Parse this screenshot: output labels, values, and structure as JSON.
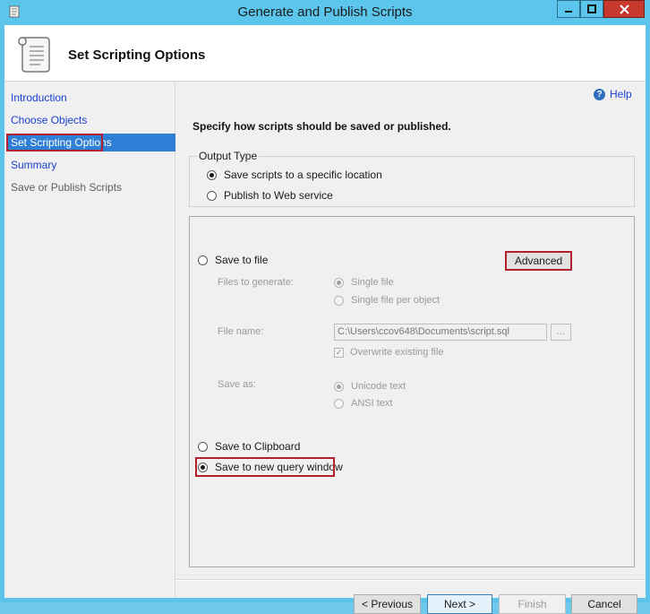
{
  "window": {
    "title": "Generate and Publish Scripts"
  },
  "header": {
    "title": "Set Scripting Options",
    "icon": "scroll-icon"
  },
  "sidebar": {
    "items": [
      {
        "label": "Introduction",
        "state": "link"
      },
      {
        "label": "Choose Objects",
        "state": "link"
      },
      {
        "label": "Set Scripting Options",
        "state": "active"
      },
      {
        "label": "Summary",
        "state": "link"
      },
      {
        "label": "Save or Publish Scripts",
        "state": "disabled"
      }
    ]
  },
  "main": {
    "help_label": "Help",
    "intro": "Specify how scripts should be saved or published.",
    "output_type": {
      "legend": "Output Type",
      "options": [
        {
          "label": "Save scripts to a specific location",
          "selected": true
        },
        {
          "label": "Publish to Web service",
          "selected": false
        }
      ]
    },
    "save": {
      "save_to_file_label": "Save to file",
      "advanced_label": "Advanced",
      "files_to_generate_label": "Files to generate:",
      "single_file_label": "Single file",
      "single_file_per_object_label": "Single file per object",
      "file_name_label": "File name:",
      "file_name_value": "C:\\Users\\ccov648\\Documents\\script.sql",
      "browse_label": "...",
      "overwrite_label": "Overwrite existing file",
      "overwrite_checked": true,
      "save_as_label": "Save as:",
      "unicode_label": "Unicode text",
      "ansi_label": "ANSI text",
      "clipboard_label": "Save to Clipboard",
      "query_window_label": "Save to new query window",
      "selected": "Save to new query window"
    }
  },
  "footer": {
    "previous_label": "< Previous",
    "next_label": "Next >",
    "finish_label": "Finish",
    "cancel_label": "Cancel"
  },
  "colors": {
    "titlebar": "#5bc5ec",
    "close_button": "#c7382e",
    "active_nav": "#2f7fd6",
    "highlight_border": "#b22030",
    "link": "#1a3fd0"
  }
}
